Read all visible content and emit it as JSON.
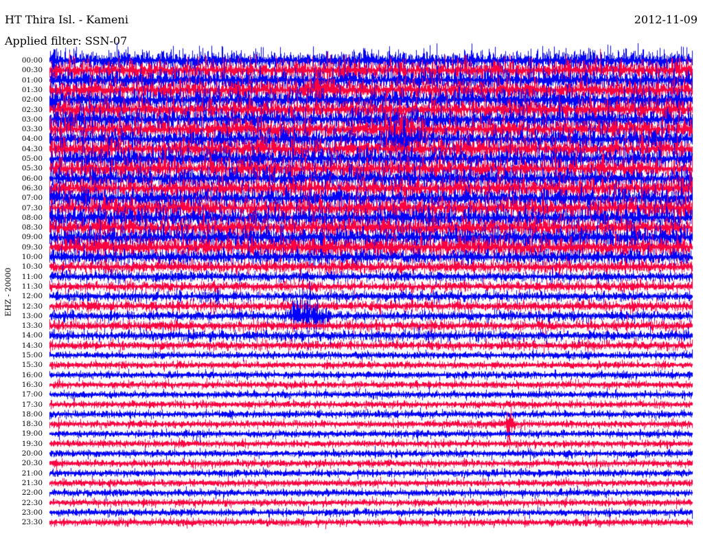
{
  "header": {
    "station": "HT Thira Isl. - Kameni",
    "date": "2012-11-09",
    "filter": "Applied filter: SSN-07"
  },
  "channel": "EHZ - 20000",
  "colors": {
    "trace_a": "#0000ff",
    "trace_b": "#ff0040",
    "background": "#ffffff"
  },
  "chart_data": {
    "type": "seismic-helicorder",
    "rows": [
      "00:00",
      "00:30",
      "01:00",
      "01:30",
      "02:00",
      "02:30",
      "03:00",
      "03:30",
      "04:00",
      "04:30",
      "05:00",
      "05:30",
      "06:00",
      "06:30",
      "07:00",
      "07:30",
      "08:00",
      "08:30",
      "09:00",
      "09:30",
      "10:00",
      "10:30",
      "11:00",
      "11:30",
      "12:00",
      "12:30",
      "13:00",
      "13:30",
      "14:00",
      "14:30",
      "15:00",
      "15:30",
      "16:00",
      "16:30",
      "17:00",
      "17:30",
      "18:00",
      "18:30",
      "19:00",
      "19:30",
      "20:00",
      "20:30",
      "21:00",
      "21:30",
      "22:00",
      "22:30",
      "23:00",
      "23:30"
    ],
    "minutes_per_row": 30,
    "trace_colors_alternate": [
      "blue",
      "red"
    ],
    "relative_noise_amplitude": [
      1.0,
      1.0,
      1.0,
      1.0,
      1.0,
      1.0,
      1.0,
      1.0,
      1.0,
      1.0,
      1.0,
      1.0,
      1.0,
      1.0,
      1.0,
      1.0,
      1.0,
      1.0,
      1.0,
      1.0,
      0.7,
      0.6,
      0.45,
      0.45,
      0.45,
      0.45,
      0.45,
      0.45,
      0.45,
      0.4,
      0.3,
      0.3,
      0.3,
      0.3,
      0.3,
      0.3,
      0.3,
      0.3,
      0.3,
      0.3,
      0.3,
      0.3,
      0.3,
      0.3,
      0.3,
      0.3,
      0.3,
      0.3
    ],
    "events": [
      {
        "row": "03:30",
        "minute": 16.5,
        "amplitude": 1.6,
        "duration_min": 1.0
      },
      {
        "row": "04:00",
        "minute": 16.5,
        "amplitude": 1.4,
        "duration_min": 1.0
      },
      {
        "row": "13:00",
        "minute": 12.0,
        "amplitude": 2.2,
        "duration_min": 1.2
      },
      {
        "row": "18:30",
        "minute": 21.5,
        "amplitude": 2.0,
        "duration_min": 0.3
      },
      {
        "row": "01:30",
        "minute": 12.5,
        "amplitude": 1.2,
        "duration_min": 0.6
      }
    ]
  }
}
